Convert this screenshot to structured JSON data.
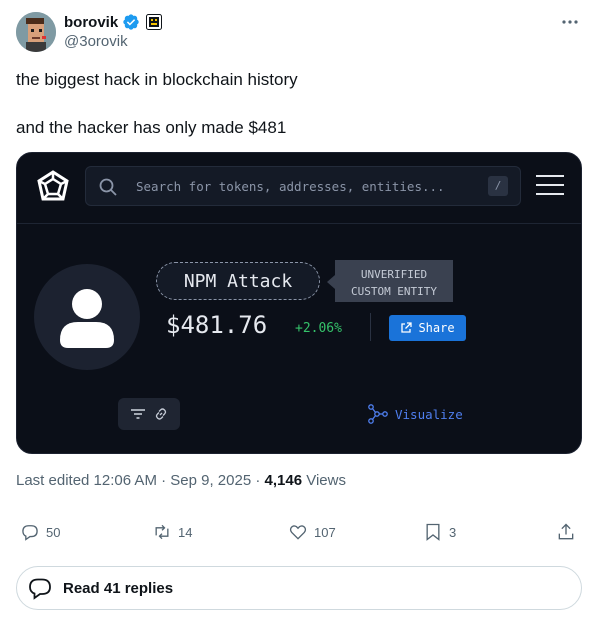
{
  "tweet": {
    "author": {
      "display_name": "borovik",
      "handle": "@3orovik"
    },
    "text_line1": "the biggest hack in blockchain history",
    "text_line2": "and the hacker has only made $481"
  },
  "card": {
    "search_placeholder": "Search for tokens, addresses, entities...",
    "search_shortcut": "/",
    "entity_name": "NPM Attack",
    "tag_line1": "UNVERIFIED",
    "tag_line2": "CUSTOM ENTITY",
    "price": "$481.76",
    "change": "+2.06%",
    "share_label": "Share",
    "visualize_label": "Visualize",
    "colors": {
      "background": "#0b0f18",
      "accent": "#1a73d9",
      "positive": "#35c26a",
      "link": "#4f7ff0"
    }
  },
  "meta": {
    "edited": "Last edited 12:06 AM · Sep 9, 2025 · ",
    "views_count": "4,146",
    "views_label": " Views"
  },
  "actions": {
    "replies": "50",
    "reposts": "14",
    "likes": "107",
    "bookmarks": "3"
  },
  "read_replies": "Read 41 replies"
}
